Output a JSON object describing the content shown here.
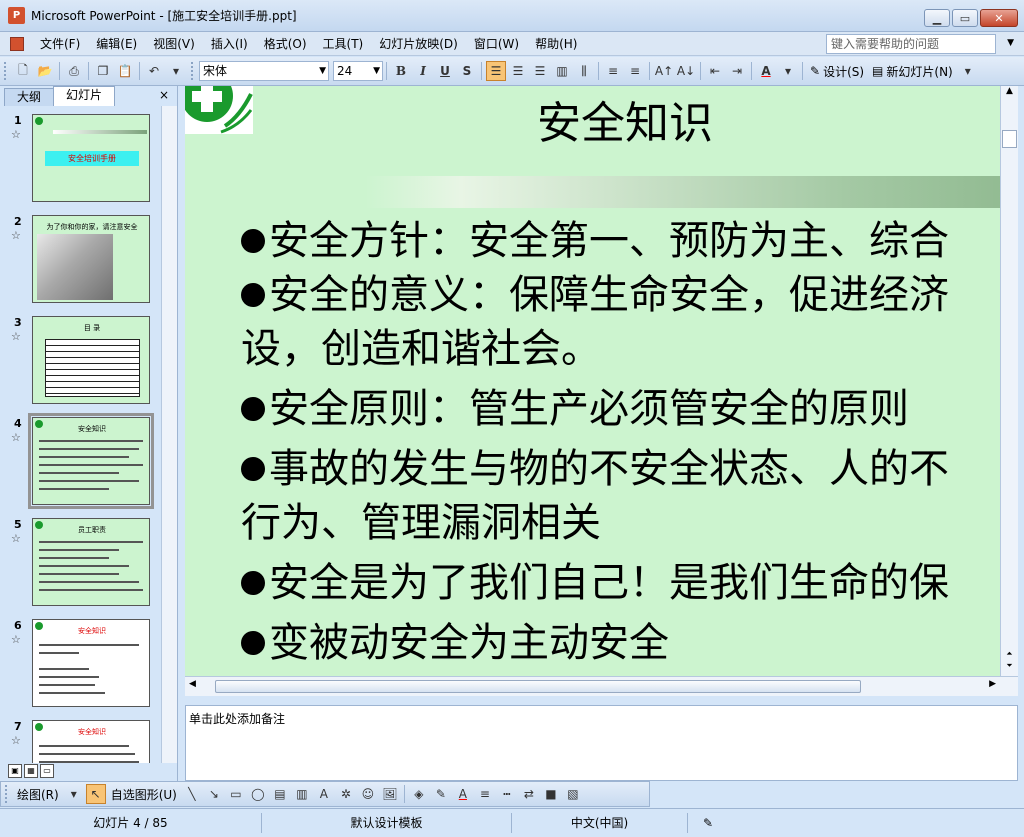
{
  "window": {
    "title": "Microsoft PowerPoint - [施工安全培训手册.ppt]",
    "app_icon": "P"
  },
  "menu": [
    "文件(F)",
    "编辑(E)",
    "视图(V)",
    "插入(I)",
    "格式(O)",
    "工具(T)",
    "幻灯片放映(D)",
    "窗口(W)",
    "帮助(H)"
  ],
  "help_placeholder": "键入需要帮助的问题",
  "toolbar": {
    "font": "宋体",
    "font_size": "24",
    "design_label": "设计(S)",
    "new_slide_label": "新幻灯片(N)"
  },
  "panel": {
    "tab_outline": "大纲",
    "tab_slides": "幻灯片",
    "close": "×"
  },
  "thumbnails": [
    {
      "num": "1",
      "title": "安全培训手册"
    },
    {
      "num": "2",
      "title": "为了你和你的家，请注意安全"
    },
    {
      "num": "3",
      "title": "目 录"
    },
    {
      "num": "4",
      "title": "安全知识"
    },
    {
      "num": "5",
      "title": "员工职责"
    },
    {
      "num": "6",
      "title": "安全知识"
    },
    {
      "num": "7",
      "title": "安全知识"
    }
  ],
  "slide": {
    "title": "安全知识",
    "bullets": [
      {
        "text": "安全方针：安全第一、预防为主、综合"
      },
      {
        "text": "安全的意义：保障生命安全，促进经济"
      },
      {
        "text": "设，创造和谐社会。",
        "cont": true
      },
      {
        "text": "安全原则：管生产必须管安全的原则"
      },
      {
        "text": "事故的发生与物的不安全状态、人的不"
      },
      {
        "text": "行为、管理漏洞相关",
        "cont": true
      },
      {
        "text": "安全是为了我们自己！是我们生命的保"
      },
      {
        "text": "变被动安全为主动安全"
      }
    ]
  },
  "notes_placeholder": "单击此处添加备注",
  "drawbar": {
    "draw_label": "绘图(R)",
    "autoshape_label": "自选图形(U)"
  },
  "status": {
    "slide_pos": "幻灯片 4 / 85",
    "template": "默认设计模板",
    "language": "中文(中国)"
  }
}
